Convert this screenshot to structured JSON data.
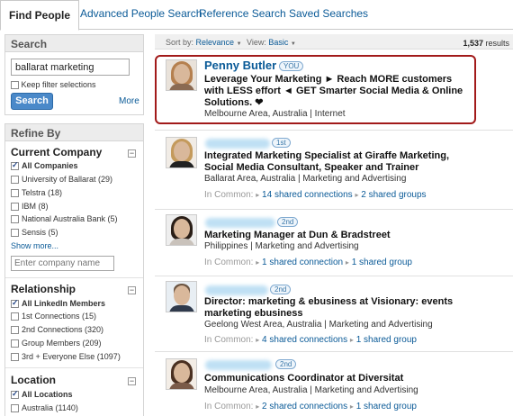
{
  "tabs": [
    {
      "label": "Find People"
    },
    {
      "label": "Advanced People Search"
    },
    {
      "label": "Reference Search"
    },
    {
      "label": "Saved Searches"
    }
  ],
  "search": {
    "title": "Search",
    "query": "ballarat marketing",
    "keep_filter_label": "Keep filter selections",
    "button_label": "Search",
    "more_label": "More"
  },
  "refine": {
    "title": "Refine By",
    "current_company": {
      "title": "Current Company",
      "items": [
        {
          "label": "All Companies",
          "checked": true
        },
        {
          "label": "University of Ballarat (29)",
          "checked": false
        },
        {
          "label": "Telstra (18)",
          "checked": false
        },
        {
          "label": "IBM (8)",
          "checked": false
        },
        {
          "label": "National Australia Bank (5)",
          "checked": false
        },
        {
          "label": "Sensis (5)",
          "checked": false
        }
      ],
      "show_more": "Show more...",
      "company_placeholder": "Enter company name"
    },
    "relationship": {
      "title": "Relationship",
      "items": [
        {
          "label": "All LinkedIn Members",
          "checked": true
        },
        {
          "label": "1st Connections (15)",
          "checked": false
        },
        {
          "label": "2nd Connections (320)",
          "checked": false
        },
        {
          "label": "Group Members (209)",
          "checked": false
        },
        {
          "label": "3rd + Everyone Else (1097)",
          "checked": false
        }
      ]
    },
    "location": {
      "title": "Location",
      "items": [
        {
          "label": "All Locations",
          "checked": true
        },
        {
          "label": "Australia (1140)",
          "checked": false
        }
      ]
    }
  },
  "sortbar": {
    "sort_label": "Sort by:",
    "sort_value": "Relevance",
    "view_label": "View:",
    "view_value": "Basic",
    "results_count": "1,537",
    "results_suffix": "results"
  },
  "results": [
    {
      "name": "Penny Butler",
      "badge": "YOU",
      "headline": "Leverage Your Marketing ► Reach MORE customers with LESS effort ◄ GET Smarter Social Media & Online Solutions. ❤",
      "location": "Melbourne Area, Australia | Internet"
    },
    {
      "degree": "1st",
      "headline": "Integrated Marketing Specialist at Giraffe Marketing, Social Media Consultant, Speaker and Trainer",
      "location": "Ballarat Area, Australia | Marketing and Advertising",
      "in_common_label": "In Common:",
      "connections": "14 shared connections",
      "groups": "2 shared groups"
    },
    {
      "degree": "2nd",
      "headline": "Marketing Manager at Dun & Bradstreet",
      "location": "Philippines | Marketing and Advertising",
      "in_common_label": "In Common:",
      "connections": "1 shared connection",
      "groups": "1 shared group"
    },
    {
      "degree": "2nd",
      "headline": "Director: marketing & ebusiness at Visionary: events marketing ebusiness",
      "location": "Geelong West Area, Australia | Marketing and Advertising",
      "in_common_label": "In Common:",
      "connections": "4 shared connections",
      "groups": "1 shared group"
    },
    {
      "degree": "2nd",
      "headline": "Communications Coordinator at Diversitat",
      "location": "Melbourne Area, Australia | Marketing and Advertising",
      "in_common_label": "In Common:",
      "connections": "2 shared connections",
      "groups": "1 shared group"
    }
  ],
  "colors": {
    "link": "#0a5a97",
    "highlight_border": "#a21a1a",
    "search_button": "#4a89c9"
  }
}
